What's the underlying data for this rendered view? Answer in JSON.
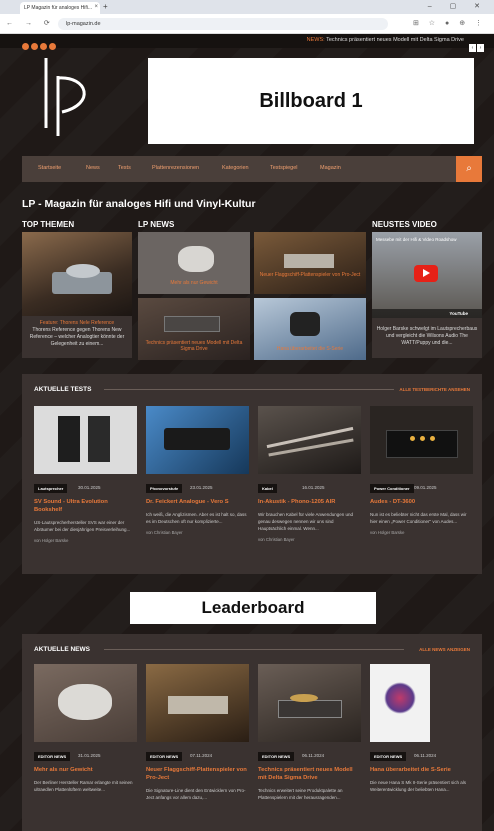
{
  "browser": {
    "tab_title": "LP Magazin für analoges Hifi...",
    "tab_close": "×",
    "new_tab": "+",
    "window_controls": "– ▢ ✕",
    "nav_buttons": "← → ⟳",
    "url": "lp-magazin.de",
    "ext_icons": "⊞ ☆ ● ⊕ ⋮"
  },
  "topbar": {
    "ticker_label": "NEWS:",
    "ticker_text": "Technics präsentiert neues Modell mit Delta Sigma Drive",
    "prev": "‹",
    "next": "›"
  },
  "billboard": "Billboard 1",
  "nav": {
    "items": [
      "Startseite",
      "News",
      "Tests",
      "Plattenrezensionen",
      "Kategorien",
      "Testspiegel",
      "Magazin"
    ],
    "search_icon": "⌕"
  },
  "tagline": "LP - Magazin für analoges Hifi und Vinyl-Kultur",
  "sections": {
    "top_themen": "TOP THEMEN",
    "lp_news": "LP NEWS",
    "video": "NEUSTES VIDEO"
  },
  "top_theme": {
    "caption_title": "Feature: Thorens Nele Reference",
    "caption_text": "Thorens Reference gegen Thorens New Reference – welcher Analogtier könnte der Gelegenheit zu einem..."
  },
  "news_tiles": [
    {
      "caption": "Mehr als nur Gewicht"
    },
    {
      "caption": "Neuer Flaggschiff-Plattenspieler von Pro-Ject"
    },
    {
      "caption": "Technics präsentiert neues Modell mit Delta Sigma Drive"
    },
    {
      "caption": "Hana überarbeitet die S-Serie"
    }
  ],
  "video": {
    "overlay_title": "Messebe mit der Hifi & Video Roadshow",
    "yt_label": "YouTube",
    "caption": "Holger Barske schwelgt im Lautsprecherbaus und vergleicht die Wilsons Audio The WATT/Puppy und die..."
  },
  "tests": {
    "title": "AKTUELLE TESTS",
    "link": "ALLE TESTBERICHTE ANSEHEN",
    "items": [
      {
        "badge": "Lautsprecher",
        "date": "30.01.2025",
        "title": "SV Sound - Ultra Evolution Bookshelf",
        "text": "US-Lautsprecherhersteller SVS war einer der Abräumer bei der diesjährigen Preisverleihung...",
        "author": "von Holger Barske"
      },
      {
        "badge": "Phonovorstufe",
        "date": "23.01.2025",
        "title": "Dr. Feickert Analogue - Vero S",
        "text": "Ich weiß, die Anglizismen. Aber es ist halt so, dass es im Deutschen oft nur komplizierte...",
        "author": "von Christian Bayer"
      },
      {
        "badge": "Kabel",
        "date": "16.01.2025",
        "title": "In-Akustik - Phono-1205 AIR",
        "text": "Wir brauchen Kabel für viele Anwendungen und genau deswegen nennen wir uns sind Hauptsächlich einmal. Wenn...",
        "author": "von Christian Bayer"
      },
      {
        "badge": "Power Conditioner",
        "date": "09.01.2025",
        "title": "Audes - DT-3600",
        "text": "Nun ist es beliebter nicht das erste Mal, dass wir hier einen „Power Conditioner\" von Audes...",
        "author": "von Holger Barske"
      }
    ]
  },
  "leaderboard": "Leaderboard",
  "news": {
    "title": "AKTUELLE NEWS",
    "link": "ALLE NEWS ANZEIGEN",
    "items": [
      {
        "badge": "EDITOR NEWS",
        "date": "31.01.2025",
        "title": "Mehr als nur Gewicht",
        "text": "Der Berliner Hersteller Ramar erlangte mit seinen ultraedlen Plattenlüftern weltweite..."
      },
      {
        "badge": "EDITOR NEWS",
        "date": "07.11.2024",
        "title": "Neuer Flaggschiff-Plattenspieler von Pro-Ject",
        "text": "Die Signature-Line dient den Entwicklern von Pro-Ject anfangs vor allem dazu,..."
      },
      {
        "badge": "EDITOR NEWS",
        "date": "06.11.2024",
        "title": "Technics präsentiert neues Modell mit Delta Sigma Drive",
        "text": "Technics erweitert seine Produktpalette an Plattenspielern mit der herausragenden..."
      },
      {
        "badge": "EDITOR NEWS",
        "date": "06.11.2024",
        "title": "Hana überarbeitet die S-Serie",
        "text": "Die neue Hana S Mk II-Serie präsentiert sich als Weiterentwicklung der beliebten Hana..."
      }
    ]
  }
}
